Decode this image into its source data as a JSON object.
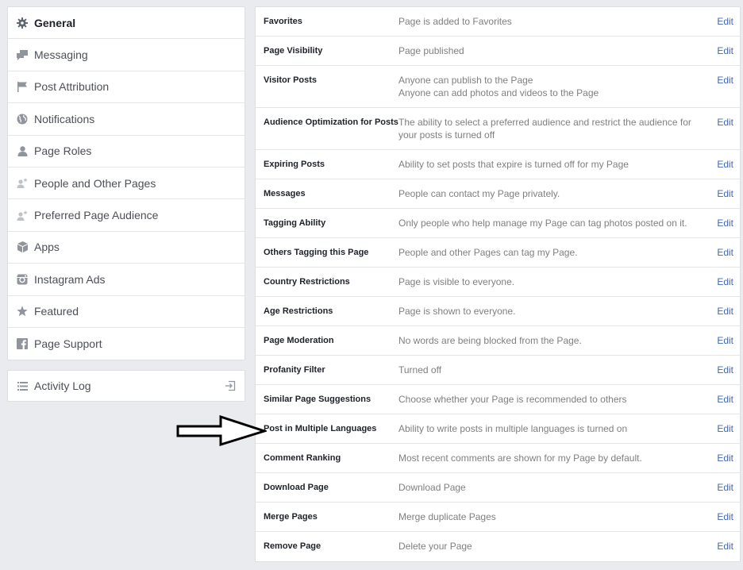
{
  "sidebar": {
    "items": [
      {
        "label": "General",
        "icon": "gear-icon",
        "active": true
      },
      {
        "label": "Messaging",
        "icon": "messages-icon"
      },
      {
        "label": "Post Attribution",
        "icon": "flag-icon"
      },
      {
        "label": "Notifications",
        "icon": "globe-icon"
      },
      {
        "label": "Page Roles",
        "icon": "person-icon"
      },
      {
        "label": "People and Other Pages",
        "icon": "person-star-icon"
      },
      {
        "label": "Preferred Page Audience",
        "icon": "person-star-icon"
      },
      {
        "label": "Apps",
        "icon": "cube-icon"
      },
      {
        "label": "Instagram Ads",
        "icon": "instagram-icon"
      },
      {
        "label": "Featured",
        "icon": "star-icon"
      },
      {
        "label": "Page Support",
        "icon": "facebook-icon"
      }
    ]
  },
  "activity_log": {
    "label": "Activity Log",
    "icon": "list-icon",
    "action_icon": "exit-icon"
  },
  "settings": {
    "edit_label": "Edit",
    "rows": [
      {
        "name": "Favorites",
        "desc": [
          "Page is added to Favorites"
        ]
      },
      {
        "name": "Page Visibility",
        "desc": [
          "Page published"
        ]
      },
      {
        "name": "Visitor Posts",
        "desc": [
          "Anyone can publish to the Page",
          "Anyone can add photos and videos to the Page"
        ]
      },
      {
        "name": "Audience Optimization for Posts",
        "desc": [
          "The ability to select a preferred audience and restrict the audience for your posts is turned off"
        ]
      },
      {
        "name": "Expiring Posts",
        "desc": [
          "Ability to set posts that expire is turned off for my Page"
        ]
      },
      {
        "name": "Messages",
        "desc": [
          "People can contact my Page privately."
        ]
      },
      {
        "name": "Tagging Ability",
        "desc": [
          "Only people who help manage my Page can tag photos posted on it."
        ]
      },
      {
        "name": "Others Tagging this Page",
        "desc": [
          "People and other Pages can tag my Page."
        ]
      },
      {
        "name": "Country Restrictions",
        "desc": [
          "Page is visible to everyone."
        ]
      },
      {
        "name": "Age Restrictions",
        "desc": [
          "Page is shown to everyone."
        ]
      },
      {
        "name": "Page Moderation",
        "desc": [
          "No words are being blocked from the Page."
        ]
      },
      {
        "name": "Profanity Filter",
        "desc": [
          "Turned off"
        ]
      },
      {
        "name": "Similar Page Suggestions",
        "desc": [
          "Choose whether your Page is recommended to others"
        ]
      },
      {
        "name": "Post in Multiple Languages",
        "desc": [
          "Ability to write posts in multiple languages is turned on"
        ]
      },
      {
        "name": "Comment Ranking",
        "desc": [
          "Most recent comments are shown for my Page by default."
        ]
      },
      {
        "name": "Download Page",
        "desc": [
          "Download Page"
        ]
      },
      {
        "name": "Merge Pages",
        "desc": [
          "Merge duplicate Pages"
        ]
      },
      {
        "name": "Remove Page",
        "desc": [
          "Delete your Page"
        ]
      }
    ]
  },
  "colors": {
    "link": "#4267b2",
    "muted": "#7f7f7f",
    "icon": "#90949c"
  }
}
